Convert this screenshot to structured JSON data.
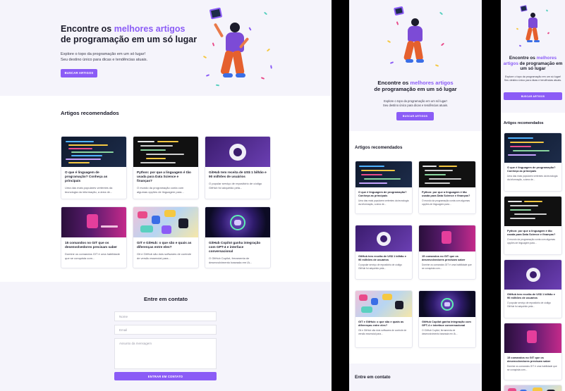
{
  "hero": {
    "title_pre": "Encontre os ",
    "title_accent": "melhores artigos",
    "title_post": "de programação em um só lugar",
    "subtitle_line1": "Explore o topo da programação em um só lugar!",
    "subtitle_line2": "Seu destino único para dicas e tendências atuais.",
    "cta_label": "BUSCAR ARTIGOS"
  },
  "articles": {
    "section_title": "Artigos recomendados",
    "items": [
      {
        "title": "O que é linguagem de programação? Conheça as principais",
        "excerpt": "Uma das mais populares vertentes da tecnologia da informação, a área de...",
        "thumb": "code-screen"
      },
      {
        "title": "Python: por que a linguagem é tão usada para Data Science e finanças?",
        "excerpt": "O mundo da programação conta com algumas opções de linguagem para...",
        "thumb": "python-code"
      },
      {
        "title": "GitHub tem receita de US$ 1 bilhão e 90 milhões de usuários",
        "excerpt": "O popular serviço de repositório de código GitHub foi adquirido pela...",
        "thumb": "github-logo"
      },
      {
        "title": "15 comandos no GIT que os desenvolvedores precisam saber",
        "excerpt": "Domine os comandos GIT é uma habilidade que se conquista com...",
        "thumb": "git-banner"
      },
      {
        "title": "GIT e GitHub: o que são e quais as diferenças entre eles?",
        "excerpt": "Git e GitHub são dois softwares de controle de versão essencial para...",
        "thumb": "stickers"
      },
      {
        "title": "GitHub Copilot ganha integração com GPT-4 e interface conversacional",
        "excerpt": "O GitHub Copilot, ferramenta de desenvolvimento baseada em IA...",
        "thumb": "copilot"
      }
    ]
  },
  "contact": {
    "section_title": "Entre em contato",
    "name_placeholder": "Nome",
    "email_placeholder": "Email",
    "message_placeholder": "Assunto da mensagem",
    "submit_label": "ENTRAR EM CONTATO"
  },
  "colors": {
    "accent": "#8b5cf6",
    "text": "#1b1b2a",
    "background": "#f8f8fc"
  }
}
